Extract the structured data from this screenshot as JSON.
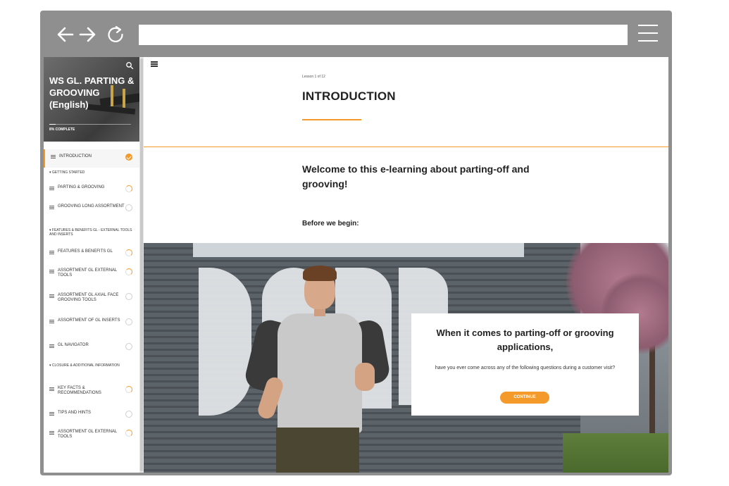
{
  "browser": {
    "url": "",
    "icons": {
      "back": "arrow-left-icon",
      "forward": "arrow-right-icon",
      "reload": "reload-icon",
      "menu": "hamburger-icon"
    }
  },
  "sidebar": {
    "course_title": "WS GL. PARTING & GROOVING (English)",
    "progress_label": "8% COMPLETE",
    "progress_value": 0.08,
    "items": [
      {
        "type": "lesson",
        "label": "INTRODUCTION",
        "status": "done",
        "active": true
      },
      {
        "type": "section",
        "label": "GETTING STARTED"
      },
      {
        "type": "lesson",
        "label": "PARTING & GROOVING",
        "status": "in-progress"
      },
      {
        "type": "lesson",
        "label": "GROOVING LONG ASSORTMENT",
        "status": "not-started"
      },
      {
        "type": "section",
        "label": "FEATURES & BENEFITS GL - EXTERNAL TOOLS AND INSERTS"
      },
      {
        "type": "lesson",
        "label": "FEATURES & BENEFITS GL",
        "status": "in-progress"
      },
      {
        "type": "lesson",
        "label": "ASSORTMENT GL EXTERNAL TOOLS",
        "status": "in-progress"
      },
      {
        "type": "lesson",
        "label": "ASSORTMENT GL AXIAL FACE GROOVING TOOLS",
        "status": "not-started"
      },
      {
        "type": "lesson",
        "label": "ASSORTMENT OF GL INSERTS",
        "status": "not-started"
      },
      {
        "type": "lesson",
        "label": "GL NAVIGATOR",
        "status": "not-started"
      },
      {
        "type": "section",
        "label": "CLOSURE & ADDITIONAL INFORMATION"
      },
      {
        "type": "lesson",
        "label": "KEY FACTS & RECOMMENDATIONS",
        "status": "in-progress"
      },
      {
        "type": "lesson",
        "label": "TIPS AND HINTS",
        "status": "not-started"
      },
      {
        "type": "lesson",
        "label": "ASSORTMENT GL EXTERNAL TOOLS",
        "status": "in-progress"
      }
    ]
  },
  "lesson": {
    "count_label": "Lesson 1 of 12",
    "title": "INTRODUCTION",
    "welcome": "Welcome to this e-learning about parting-off and grooving!",
    "before_label": "Before we begin:"
  },
  "card": {
    "title": "When it comes to parting-off or grooving applications,",
    "text": "have you ever come across any of the following questions during a customer visit?",
    "button_label": "CONTINUE"
  },
  "colors": {
    "accent": "#f39a2b",
    "browser_chrome": "#8f8f8f"
  }
}
